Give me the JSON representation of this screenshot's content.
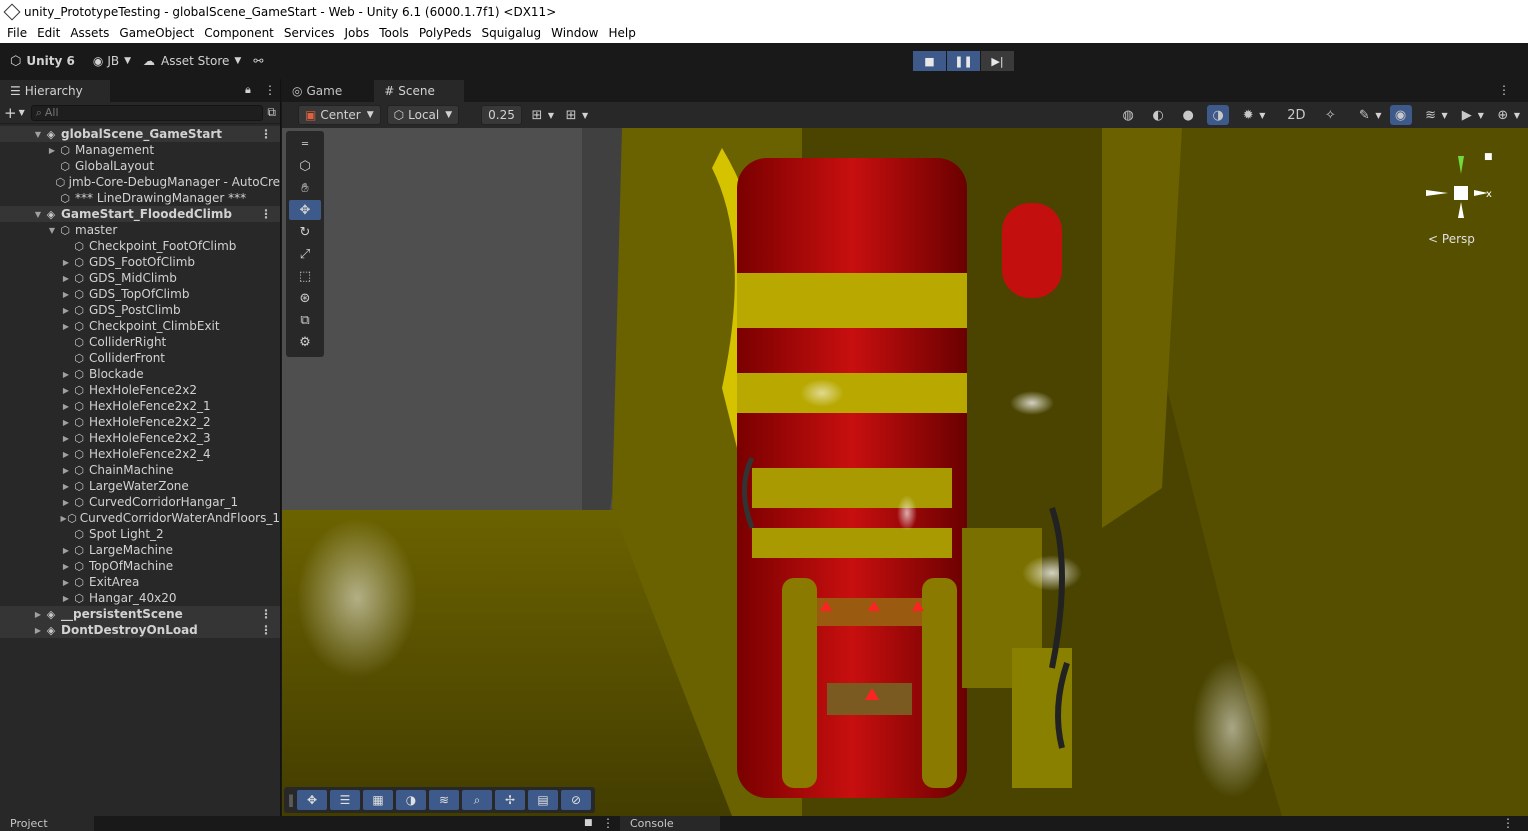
{
  "window": {
    "title": "unity_PrototypeTesting - globalScene_GameStart - Web - Unity 6.1 (6000.1.7f1) <DX11>"
  },
  "menu": [
    "File",
    "Edit",
    "Assets",
    "GameObject",
    "Component",
    "Services",
    "Jobs",
    "Tools",
    "PolyPeds",
    "Squigalug",
    "Window",
    "Help"
  ],
  "toolbar": {
    "product": "Unity 6",
    "account": "JB",
    "asset_store": "Asset Store"
  },
  "hierarchy": {
    "tab_label": "Hierarchy",
    "search_placeholder": "All",
    "rows": [
      {
        "label": "globalScene_GameStart",
        "depth": 0,
        "kind": "scene",
        "expanded": true
      },
      {
        "label": "Management",
        "depth": 1,
        "kind": "obj",
        "arrow": "right"
      },
      {
        "label": "GlobalLayout",
        "depth": 1,
        "kind": "obj"
      },
      {
        "label": "jmb-Core-DebugManager - AutoCre",
        "depth": 1,
        "kind": "obj"
      },
      {
        "label": "*** LineDrawingManager ***",
        "depth": 1,
        "kind": "obj"
      },
      {
        "label": "GameStart_FloodedClimb",
        "depth": 0,
        "kind": "scene",
        "expanded": true
      },
      {
        "label": "master",
        "depth": 1,
        "kind": "obj",
        "arrow": "down"
      },
      {
        "label": "Checkpoint_FootOfClimb",
        "depth": 2,
        "kind": "obj"
      },
      {
        "label": "GDS_FootOfClimb",
        "depth": 2,
        "kind": "obj",
        "arrow": "right"
      },
      {
        "label": "GDS_MidClimb",
        "depth": 2,
        "kind": "obj",
        "arrow": "right"
      },
      {
        "label": "GDS_TopOfClimb",
        "depth": 2,
        "kind": "obj",
        "arrow": "right"
      },
      {
        "label": "GDS_PostClimb",
        "depth": 2,
        "kind": "obj",
        "arrow": "right"
      },
      {
        "label": "Checkpoint_ClimbExit",
        "depth": 2,
        "kind": "obj",
        "arrow": "right"
      },
      {
        "label": "ColliderRight",
        "depth": 2,
        "kind": "obj"
      },
      {
        "label": "ColliderFront",
        "depth": 2,
        "kind": "obj"
      },
      {
        "label": "Blockade",
        "depth": 2,
        "kind": "obj",
        "arrow": "right"
      },
      {
        "label": "HexHoleFence2x2",
        "depth": 2,
        "kind": "obj",
        "arrow": "right"
      },
      {
        "label": "HexHoleFence2x2_1",
        "depth": 2,
        "kind": "obj",
        "arrow": "right"
      },
      {
        "label": "HexHoleFence2x2_2",
        "depth": 2,
        "kind": "obj",
        "arrow": "right"
      },
      {
        "label": "HexHoleFence2x2_3",
        "depth": 2,
        "kind": "obj",
        "arrow": "right"
      },
      {
        "label": "HexHoleFence2x2_4",
        "depth": 2,
        "kind": "obj",
        "arrow": "right"
      },
      {
        "label": "ChainMachine",
        "depth": 2,
        "kind": "obj",
        "arrow": "right"
      },
      {
        "label": "LargeWaterZone",
        "depth": 2,
        "kind": "obj",
        "arrow": "right"
      },
      {
        "label": "CurvedCorridorHangar_1",
        "depth": 2,
        "kind": "obj",
        "arrow": "right"
      },
      {
        "label": "CurvedCorridorWaterAndFloors_1",
        "depth": 2,
        "kind": "obj",
        "arrow": "right"
      },
      {
        "label": "Spot Light_2",
        "depth": 2,
        "kind": "obj"
      },
      {
        "label": "LargeMachine",
        "depth": 2,
        "kind": "obj",
        "arrow": "right"
      },
      {
        "label": "TopOfMachine",
        "depth": 2,
        "kind": "obj",
        "arrow": "right"
      },
      {
        "label": "ExitArea",
        "depth": 2,
        "kind": "obj",
        "arrow": "right"
      },
      {
        "label": "Hangar_40x20",
        "depth": 2,
        "kind": "obj",
        "arrow": "right"
      },
      {
        "label": "__persistentScene",
        "depth": 0,
        "kind": "scene",
        "expanded": false
      },
      {
        "label": "DontDestroyOnLoad",
        "depth": 0,
        "kind": "scene",
        "expanded": false
      }
    ]
  },
  "scene_tabs": {
    "game": "Game",
    "scene": "Scene"
  },
  "scene_toolbar": {
    "pivot": "Center",
    "space": "Local",
    "snap_value": "0.25"
  },
  "scene_view": {
    "projection": "Persp",
    "gizmo_axis": "x"
  },
  "bottom_tabs": {
    "project": "Project",
    "console": "Console"
  },
  "colors": {
    "accent": "#3d5a8a",
    "panel": "#282828",
    "background": "#191919"
  }
}
